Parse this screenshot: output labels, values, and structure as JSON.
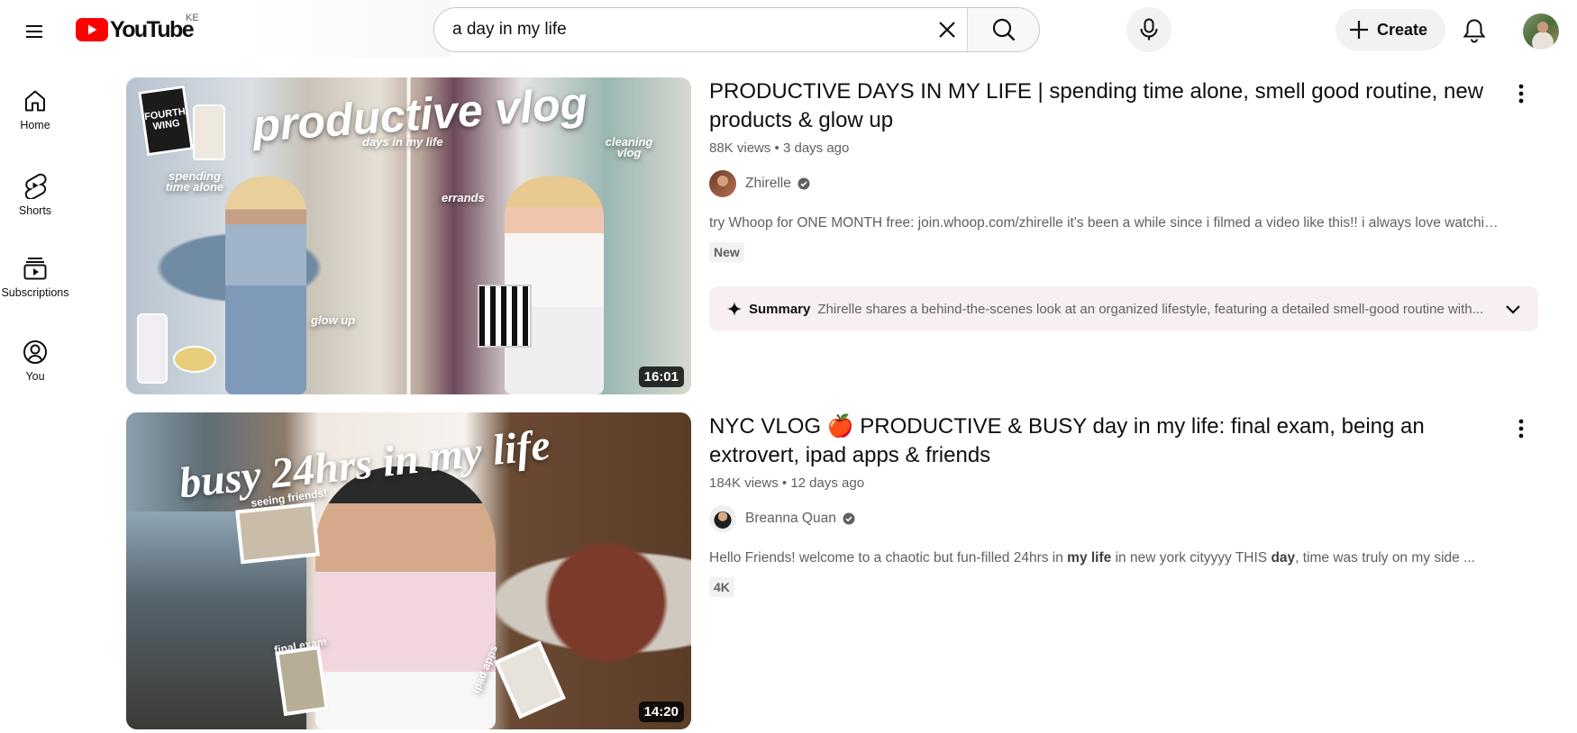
{
  "header": {
    "logo_text": "YouTube",
    "country_code": "KE",
    "search": {
      "value": "a day in my life",
      "placeholder": "Search"
    },
    "create_label": "Create"
  },
  "sidebar": {
    "items": [
      {
        "label": "Home",
        "icon": "home-icon"
      },
      {
        "label": "Shorts",
        "icon": "shorts-icon"
      },
      {
        "label": "Subscriptions",
        "icon": "subscriptions-icon"
      },
      {
        "label": "You",
        "icon": "you-icon"
      }
    ]
  },
  "results": [
    {
      "title": "PRODUCTIVE DAYS IN MY LIFE | spending time alone, smell good routine, new products & glow up",
      "views": "88K views",
      "age": "3 days ago",
      "channel": "Zhirelle",
      "description": "try Whoop for ONE MONTH free: join.whoop.com/zhirelle it's been a while since i filmed a video like this!! i always love watching ...",
      "badge": "New",
      "duration": "16:01",
      "summary_label": "Summary",
      "summary_text": "Zhirelle shares a behind-the-scenes look at an organized lifestyle, featuring a detailed smell-good routine with...",
      "thumb_texts": {
        "main": "productive vlog",
        "a": "days in my life",
        "b": "spending time alone",
        "c": "errands",
        "d": "cleaning vlog",
        "e": "glow up",
        "book": "FOURTH WING"
      }
    },
    {
      "title": "NYC VLOG 🍎 PRODUCTIVE & BUSY day in my life: final exam, being an extrovert, ipad apps & friends",
      "views": "184K views",
      "age": "12 days ago",
      "channel": "Breanna Quan",
      "description_parts": [
        "Hello Friends! welcome to a chaotic but fun-filled 24hrs in ",
        "my life",
        " in new york cityyyy THIS ",
        "day",
        ", time was truly on my side ..."
      ],
      "badge": "4K",
      "duration": "14:20",
      "thumb_texts": {
        "main": "busy 24hrs in my life",
        "a": "seeing friends!",
        "b": "final exam",
        "c": "ipad apps"
      }
    }
  ],
  "colors": {
    "brand_red": "#ff0000",
    "summary_bg": "#f8f0f0",
    "meta_text": "#606060"
  }
}
